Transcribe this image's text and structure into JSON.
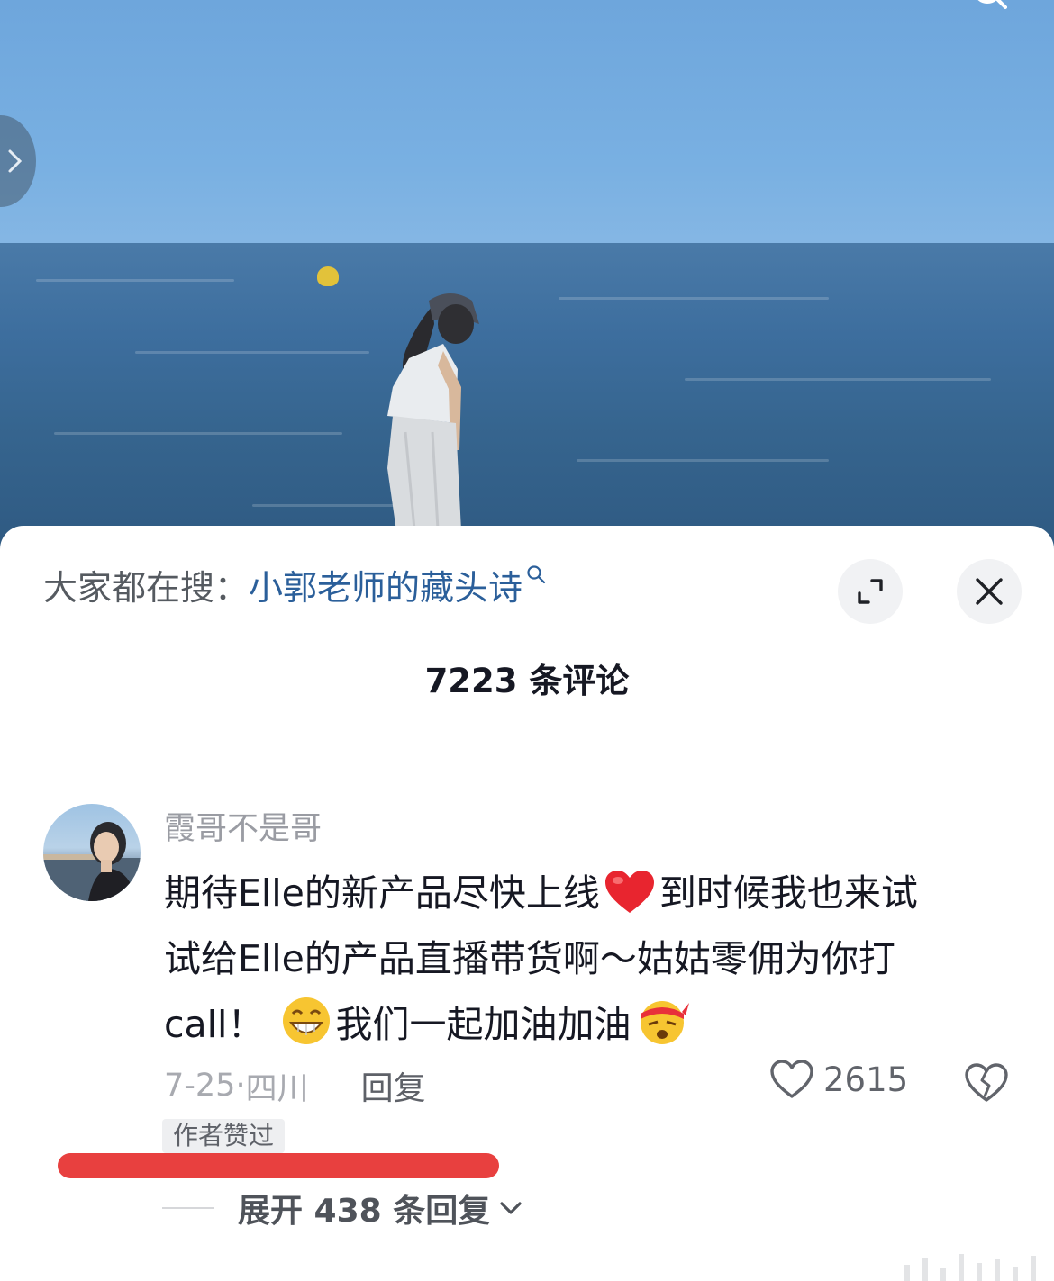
{
  "search_suggestion": {
    "label": "大家都在搜：",
    "term": "小郭老师的藏头诗"
  },
  "comment_header": {
    "title": "7223 条评论"
  },
  "comment": {
    "username": "霞哥不是哥",
    "text_line1_a": "期待Elle的新产品尽快上线",
    "text_line1_b": "到时候我也来试",
    "text_line2": "试给Elle的产品直播带货啊～姑姑零佣为你打",
    "text_line3_a": "call！",
    "text_line3_b": "我们一起加油加油",
    "date": "7-25",
    "separator": "·",
    "location": "四川",
    "reply_label": "回复",
    "likes": "2615",
    "author_badge": "作者赞过",
    "expand_replies": "展开 438 条回复",
    "emojis": [
      "heart-emoji",
      "grin-emoji",
      "headband-emoji"
    ]
  },
  "icons": [
    "chevron-right-icon",
    "search-icon",
    "expand-icon",
    "close-icon",
    "heart-icon",
    "broken-heart-icon",
    "chevron-down-icon"
  ],
  "colors": {
    "accent_link": "#2b5f9a",
    "text_primary": "#161823",
    "text_secondary": "#9a9ca3",
    "annotation_red": "#e8403f"
  }
}
